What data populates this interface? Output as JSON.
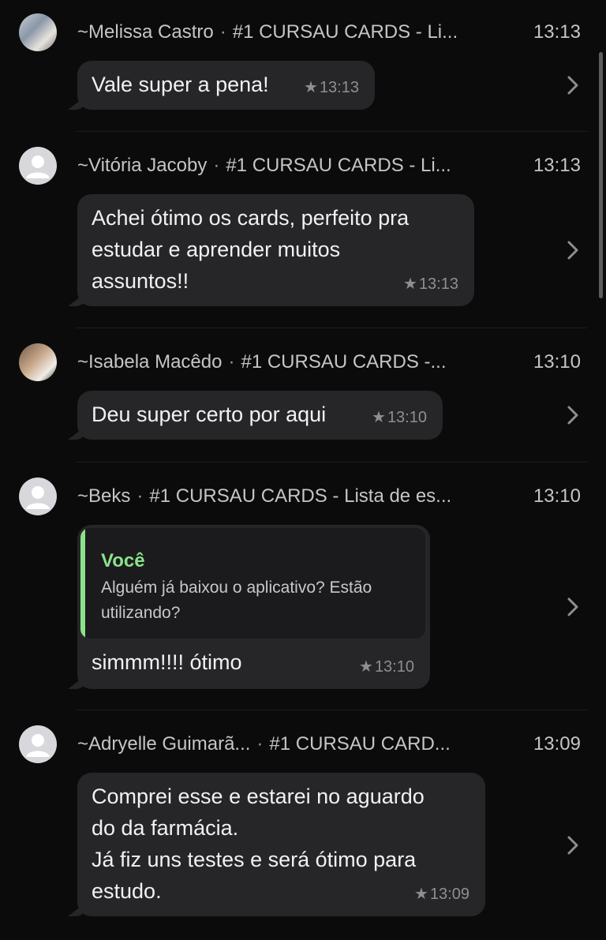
{
  "messages": [
    {
      "sender": "~Melissa Castro",
      "group": "#1 CURSAU CARDS - Li...",
      "time": "13:13",
      "text": "Vale super a pena!",
      "meta_time": "13:13",
      "avatar": "photo-a"
    },
    {
      "sender": "~Vitória Jacoby",
      "group": "#1 CURSAU CARDS - Li...",
      "time": "13:13",
      "text": "Achei ótimo os cards, perfeito pra\nestudar e aprender muitos\nassuntos!!",
      "meta_time": "13:13",
      "avatar": "default"
    },
    {
      "sender": "~Isabela Macêdo",
      "group": "#1 CURSAU CARDS -...",
      "time": "13:10",
      "text": "Deu super certo por aqui",
      "meta_time": "13:10",
      "avatar": "photo-b"
    },
    {
      "sender": "~Beks",
      "group": "#1 CURSAU CARDS - Lista de es...",
      "time": "13:10",
      "quote_name": "Você",
      "quote_text": "Alguém já baixou o aplicativo? Estão utilizando?",
      "text": "simmm!!!! ótimo",
      "meta_time": "13:10",
      "avatar": "default"
    },
    {
      "sender": "~Adryelle Guimarã...",
      "group": "#1 CURSAU CARD...",
      "time": "13:09",
      "text": "Comprei esse e estarei no aguardo\ndo da farmácia.\nJá fiz uns testes e será ótimo para\nestudo.",
      "meta_time": "13:09",
      "avatar": "default"
    }
  ],
  "icons": {
    "star": "star-icon",
    "chevron": "chevron-right-icon",
    "avatar_default": "person-placeholder-icon"
  },
  "colors": {
    "background": "#0b0b0b",
    "bubble": "#262628",
    "quote_accent": "#8be28b",
    "text_secondary": "#8e8e93"
  },
  "star_glyph": "★",
  "separator": "·"
}
